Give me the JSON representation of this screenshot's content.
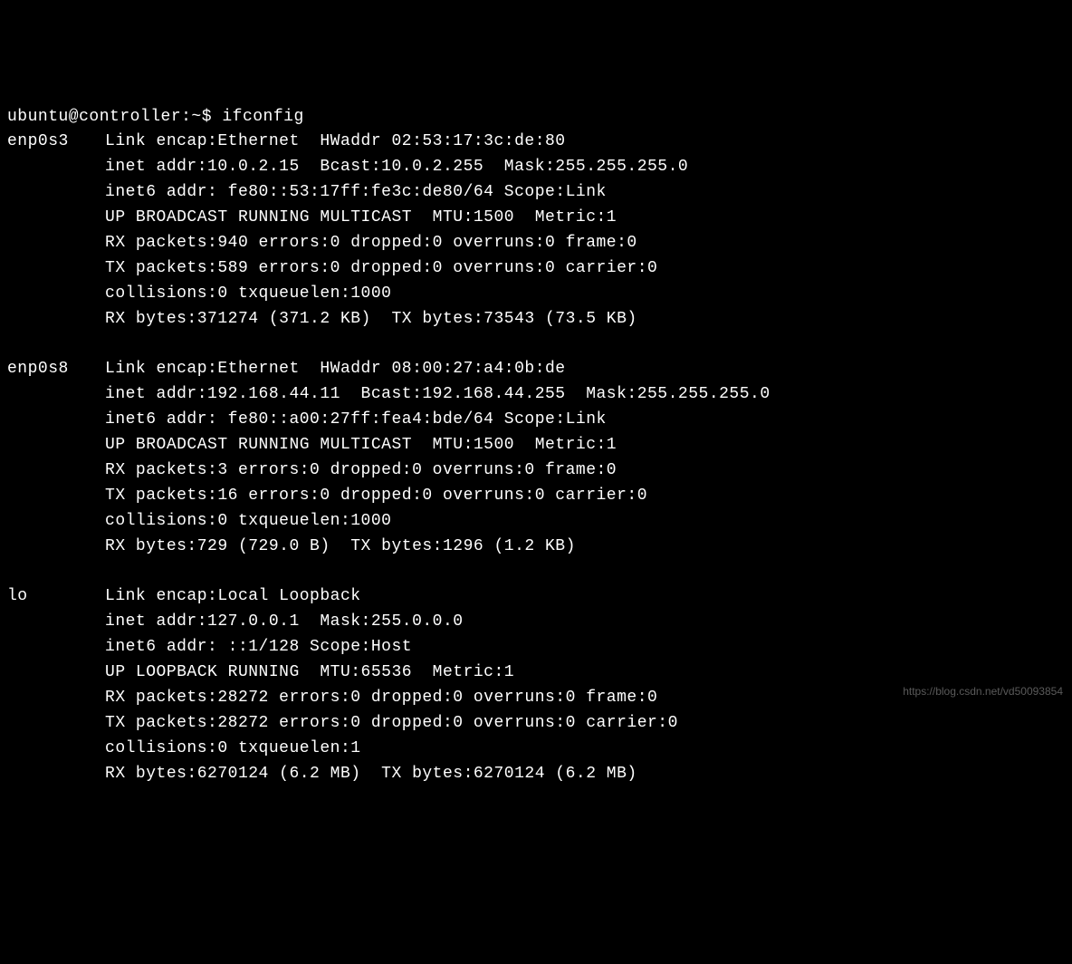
{
  "prompt": "ubuntu@controller:~$ ",
  "command": "ifconfig",
  "interfaces": [
    {
      "name": "enp0s3",
      "lines": [
        "Link encap:Ethernet  HWaddr 02:53:17:3c:de:80",
        "inet addr:10.0.2.15  Bcast:10.0.2.255  Mask:255.255.255.0",
        "inet6 addr: fe80::53:17ff:fe3c:de80/64 Scope:Link",
        "UP BROADCAST RUNNING MULTICAST  MTU:1500  Metric:1",
        "RX packets:940 errors:0 dropped:0 overruns:0 frame:0",
        "TX packets:589 errors:0 dropped:0 overruns:0 carrier:0",
        "collisions:0 txqueuelen:1000",
        "RX bytes:371274 (371.2 KB)  TX bytes:73543 (73.5 KB)"
      ]
    },
    {
      "name": "enp0s8",
      "lines": [
        "Link encap:Ethernet  HWaddr 08:00:27:a4:0b:de",
        "inet addr:192.168.44.11  Bcast:192.168.44.255  Mask:255.255.255.0",
        "inet6 addr: fe80::a00:27ff:fea4:bde/64 Scope:Link",
        "UP BROADCAST RUNNING MULTICAST  MTU:1500  Metric:1",
        "RX packets:3 errors:0 dropped:0 overruns:0 frame:0",
        "TX packets:16 errors:0 dropped:0 overruns:0 carrier:0",
        "collisions:0 txqueuelen:1000",
        "RX bytes:729 (729.0 B)  TX bytes:1296 (1.2 KB)"
      ]
    },
    {
      "name": "lo",
      "lines": [
        "Link encap:Local Loopback",
        "inet addr:127.0.0.1  Mask:255.0.0.0",
        "inet6 addr: ::1/128 Scope:Host",
        "UP LOOPBACK RUNNING  MTU:65536  Metric:1",
        "RX packets:28272 errors:0 dropped:0 overruns:0 frame:0",
        "TX packets:28272 errors:0 dropped:0 overruns:0 carrier:0",
        "collisions:0 txqueuelen:1",
        "RX bytes:6270124 (6.2 MB)  TX bytes:6270124 (6.2 MB)"
      ]
    }
  ],
  "watermark": "https://blog.csdn.net/vd50093854"
}
